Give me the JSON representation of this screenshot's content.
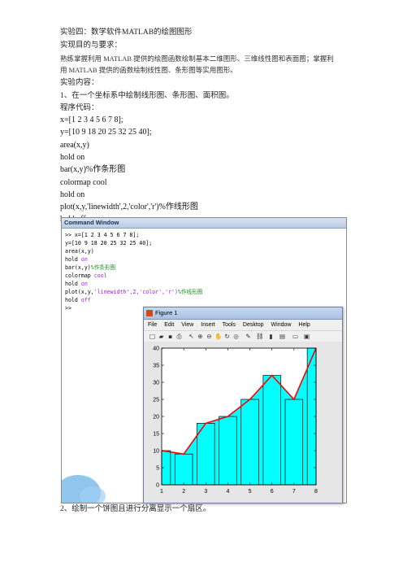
{
  "doc": {
    "title": "实验四：数学软件MATLAB的绘图图形",
    "purpose_heading": "实现目的与要求：",
    "purpose_line1": "熟练掌握利用 MATLAB 提供的绘图函数绘制基本二维图形、三维线性图和表面图；掌握利",
    "purpose_line2": "用 MATLAB 提供的函数绘制线性图、条形图等实用图形。",
    "content_heading": "实验内容：",
    "item1": "1、在一个坐标系中绘制线形图、条形图、面积图。",
    "code_heading": "程序代码：",
    "code": [
      "x=[1 2 3 4 5 6 7 8];",
      "y=[10 9 18 20 25 32 25 40];",
      "area(x,y)",
      "hold on",
      "bar(x,y)%作条形图",
      "colormap cool",
      "hold on",
      "plot(x,y,'linewidth',2,'color','r')%作线形图",
      "hold off"
    ],
    "item2": "2、绘制一个饼图且进行分离显示一个扇区。"
  },
  "command_window": {
    "title": "Command Window",
    "lines": [
      {
        "prompt": ">> ",
        "code": "x=[1 2 3 4 5 6 7 8];"
      },
      {
        "prompt": "",
        "code": "y=[10 9 18 20 25 32 25 40];"
      },
      {
        "prompt": "",
        "code": "area(x,y)"
      },
      {
        "prompt": "",
        "code": "hold on",
        "kw": true
      },
      {
        "prompt": "",
        "code": "bar(x,y)",
        "comment": "%作条形图"
      },
      {
        "prompt": "",
        "code": "colormap cool",
        "kw": true
      },
      {
        "prompt": "",
        "code": "hold on",
        "kw": true
      },
      {
        "prompt": "",
        "code": "plot(x,y,",
        "tail": "'linewidth',2,'color','r')",
        "comment": "%作线形图"
      },
      {
        "prompt": "",
        "code": "hold off",
        "kw": true
      },
      {
        "prompt": ">> ",
        "code": ""
      }
    ]
  },
  "figure": {
    "title": "Figure 1",
    "menu": [
      "File",
      "Edit",
      "View",
      "Insert",
      "Tools",
      "Desktop",
      "Window",
      "Help"
    ],
    "toolbar_icons": [
      "new-file-icon",
      "open-folder-icon",
      "save-icon",
      "print-icon",
      "pointer-icon",
      "zoom-in-icon",
      "zoom-out-icon",
      "pan-icon",
      "rotate-icon",
      "data-cursor-icon",
      "brush-icon",
      "link-icon",
      "colorbar-icon",
      "legend-icon",
      "hide-tools-icon",
      "show-tools-icon"
    ]
  },
  "chart_data": {
    "type": "bar",
    "x": [
      1,
      2,
      3,
      4,
      5,
      6,
      7,
      8
    ],
    "values": [
      10,
      9,
      18,
      20,
      25,
      32,
      25,
      40
    ],
    "xticks": [
      "1",
      "2",
      "3",
      "4",
      "5",
      "6",
      "7",
      "8"
    ],
    "yticks": [
      "0",
      "5",
      "10",
      "15",
      "20",
      "25",
      "30",
      "35",
      "40"
    ],
    "xlim": [
      1,
      8
    ],
    "ylim": [
      0,
      40
    ],
    "grid": false,
    "bar_color": "#00ffff",
    "area_color": "#00ffff",
    "line_color": "#ff0000"
  }
}
